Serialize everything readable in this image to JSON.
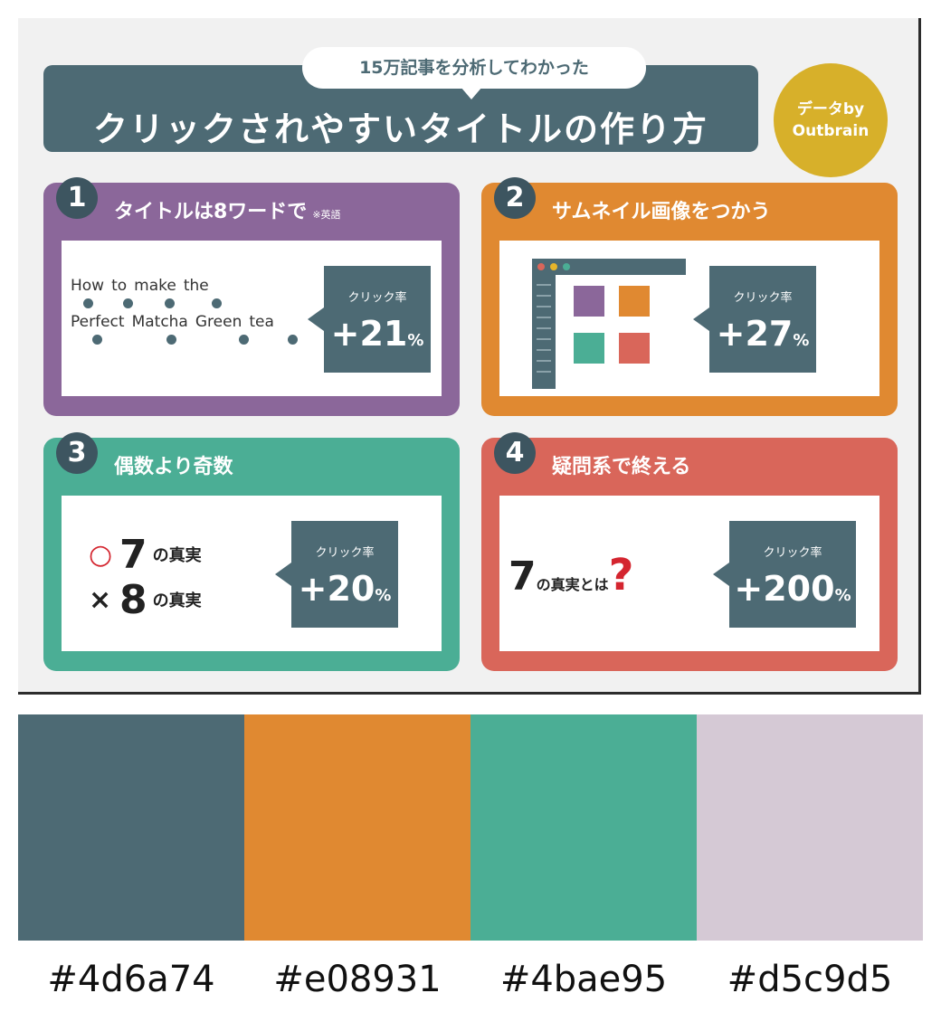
{
  "subtitle": "15万記事を分析してわかった",
  "title": "クリックされやすいタイトルの作り方",
  "data_by": {
    "line1": "データby",
    "line2": "Outbrain"
  },
  "colors": {
    "card1": "#8b679a",
    "card2": "#e08931",
    "card3": "#4bae95",
    "card4": "#d9665a",
    "badge": "#4d6a74",
    "title": "#4d6a74"
  },
  "cards": [
    {
      "num": "1",
      "heading": "タイトルは8ワードで",
      "note": "※英語",
      "words_line1": [
        "How",
        "to",
        "make",
        "the"
      ],
      "words_line2": [
        "Perfect",
        "Matcha",
        "Green",
        "tea"
      ],
      "badge_label": "クリック率",
      "badge_value": "+21",
      "badge_unit": "%"
    },
    {
      "num": "2",
      "heading": "サムネイル画像をつかう",
      "badge_label": "クリック率",
      "badge_value": "+27",
      "badge_unit": "%"
    },
    {
      "num": "3",
      "heading": "偶数より奇数",
      "good_symbol": "○",
      "good_num": "7",
      "good_text": "の真実",
      "bad_symbol": "×",
      "bad_num": "8",
      "bad_text": "の真実",
      "badge_label": "クリック率",
      "badge_value": "+20",
      "badge_unit": "%"
    },
    {
      "num": "4",
      "heading": "疑問系で終える",
      "q_num": "7",
      "q_text": "の真実とは",
      "q_mark": "?",
      "badge_label": "クリック率",
      "badge_value": "+200",
      "badge_unit": "%"
    }
  ],
  "palette": [
    {
      "hex": "#4d6a74",
      "label": "#4d6a74"
    },
    {
      "hex": "#e08931",
      "label": "#e08931"
    },
    {
      "hex": "#4bae95",
      "label": "#4bae95"
    },
    {
      "hex": "#d5c9d5",
      "label": "#d5c9d5"
    }
  ]
}
